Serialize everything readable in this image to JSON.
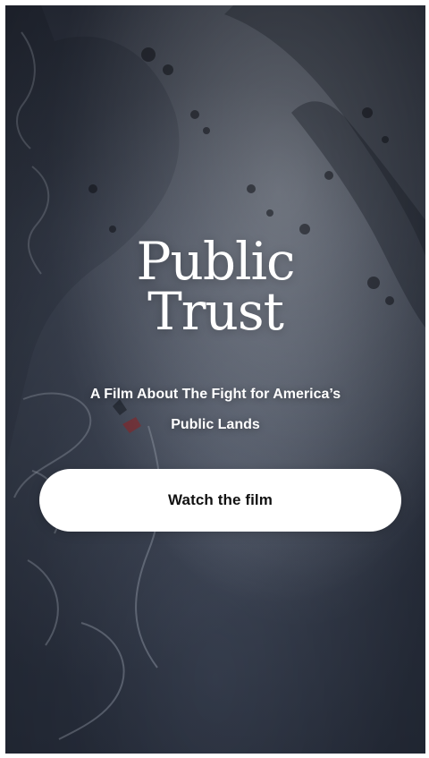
{
  "hero": {
    "title_lines": [
      "Public",
      "Trust"
    ],
    "subtitle_lines": [
      "A Film About The Fight for America’s",
      "Public Lands"
    ],
    "cta_label": "Watch the film"
  },
  "colors": {
    "cta_background": "#ffffff",
    "cta_text": "#111111",
    "hero_text": "#ffffff",
    "hero_background": "#343c4d"
  }
}
